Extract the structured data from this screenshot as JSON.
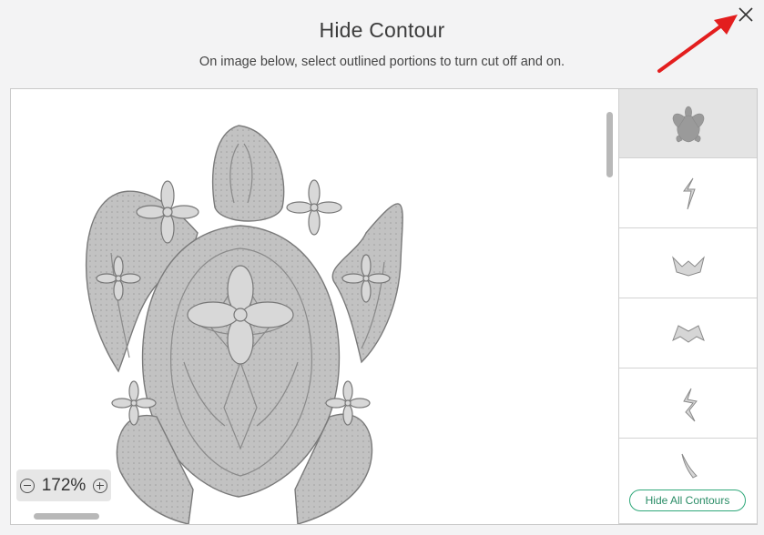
{
  "dialog": {
    "title": "Hide Contour",
    "subtitle": "On image below, select outlined portions to turn cut off and on.",
    "close_icon": "close-icon"
  },
  "canvas": {
    "image": "sea-turtle-mandala",
    "zoom": {
      "value": "172%",
      "minus_icon": "zoom-out-icon",
      "plus_icon": "zoom-in-icon"
    }
  },
  "layers": {
    "items": [
      {
        "name": "full-turtle",
        "selected": true
      },
      {
        "name": "piece-1",
        "selected": false
      },
      {
        "name": "piece-2",
        "selected": false
      },
      {
        "name": "piece-3",
        "selected": false
      },
      {
        "name": "piece-4",
        "selected": false
      },
      {
        "name": "piece-5",
        "selected": false
      }
    ],
    "hide_all_label": "Hide All Contours"
  },
  "colors": {
    "accent": "#2fa87a",
    "arrow": "#e31e1e",
    "artwork_fill": "#bdbdbd",
    "artwork_stroke": "#7a7a7a"
  }
}
